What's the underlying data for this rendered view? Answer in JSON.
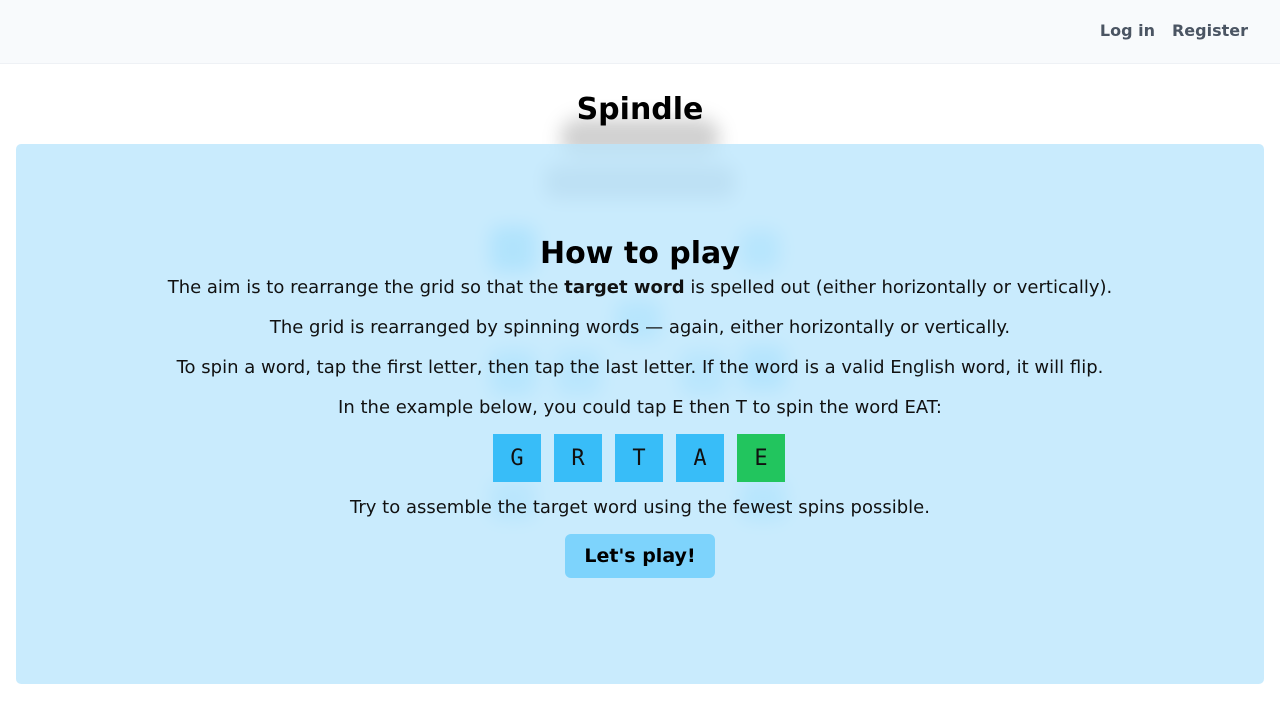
{
  "nav": {
    "login_label": "Log in",
    "register_label": "Register"
  },
  "app": {
    "title": "Spindle"
  },
  "modal": {
    "title": "How to play",
    "para1_before": "The aim is to rearrange the grid so that the ",
    "para1_bold": "target word",
    "para1_after": " is spelled out (either horizontally or vertically).",
    "para2": "The grid is rearranged by spinning words — again, either horizontally or vertically.",
    "para3": "To spin a word, tap the first letter, then tap the last letter. If the word is a valid English word, it will flip.",
    "para4": "In the example below, you could tap E then T to spin the word EAT:",
    "example_tiles": [
      {
        "letter": "G",
        "color": "#38bdf8"
      },
      {
        "letter": "R",
        "color": "#38bdf8"
      },
      {
        "letter": "T",
        "color": "#38bdf8"
      },
      {
        "letter": "A",
        "color": "#38bdf8"
      },
      {
        "letter": "E",
        "color": "#22c55e"
      }
    ],
    "para5": "Try to assemble the target word using the fewest spins possible.",
    "play_label": "Let's play!"
  },
  "colors": {
    "overlay": "#bae6fd",
    "tile_blue": "#38bdf8",
    "tile_green": "#22c55e",
    "button": "#7dd3fc",
    "topbar": "#f8fafc",
    "nav_text": "#4b5563"
  }
}
